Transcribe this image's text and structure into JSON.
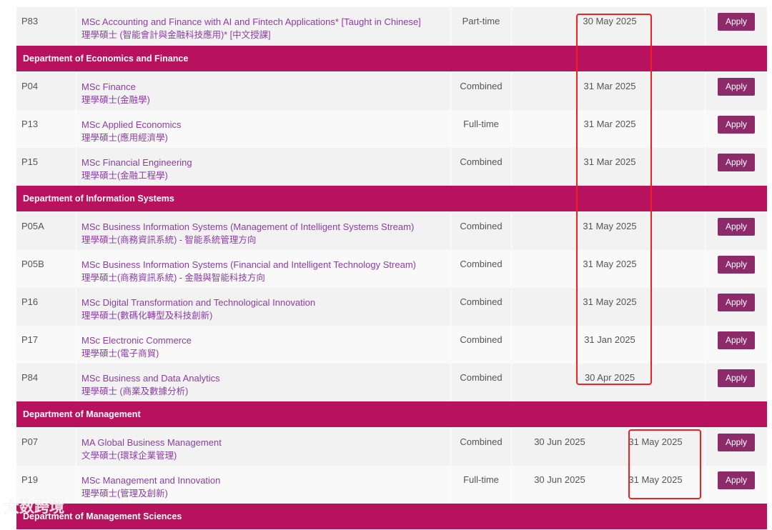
{
  "colors": {
    "dept_bg": "#b8125f",
    "link": "#8b3da3",
    "apply_bg": "#8d2a6a",
    "highlight": "#ee2020"
  },
  "apply_label": "Apply",
  "rows": [
    {
      "kind": "prog",
      "code": "P83",
      "en": "MSc Accounting and Finance with AI and Fintech Applications* [Taught in Chinese]",
      "zh": "理學碩士 (智能會計與金融科技應用)* [中文授課]",
      "mode": "Part-time",
      "date1": "",
      "date2": "30 May 2025"
    },
    {
      "kind": "dept",
      "label": "Department of Economics and Finance"
    },
    {
      "kind": "prog",
      "code": "P04",
      "en": "MSc Finance",
      "zh": "理學碩士(金融學)",
      "mode": "Combined",
      "date1": "",
      "date2": "31 Mar 2025"
    },
    {
      "kind": "prog",
      "code": "P13",
      "en": "MSc Applied Economics",
      "zh": "理學碩士(應用經濟學)",
      "mode": "Full-time",
      "date1": "",
      "date2": "31 Mar 2025"
    },
    {
      "kind": "prog",
      "code": "P15",
      "en": "MSc Financial Engineering",
      "zh": "理學碩士(金融工程學)",
      "mode": "Combined",
      "date1": "",
      "date2": "31 Mar 2025"
    },
    {
      "kind": "dept",
      "label": "Department of Information Systems"
    },
    {
      "kind": "prog",
      "code": "P05A",
      "en": "MSc Business Information Systems (Management of Intelligent Systems Stream)",
      "zh": "理學碩士(商務資訊系統) - 智能系統管理方向",
      "mode": "Combined",
      "date1": "",
      "date2": "31 May 2025"
    },
    {
      "kind": "prog",
      "code": "P05B",
      "en": "MSc Business Information Systems (Financial and Intelligent Technology Stream)",
      "zh": "理學碩士(商務資訊系統) - 金融與智能科技方向",
      "mode": "Combined",
      "date1": "",
      "date2": "31 May 2025"
    },
    {
      "kind": "prog",
      "code": "P16",
      "en": "MSc Digital Transformation and Technological Innovation",
      "zh": "理學碩士(數碼化轉型及科技創新)",
      "mode": "Combined",
      "date1": "",
      "date2": "31 May 2025"
    },
    {
      "kind": "prog",
      "code": "P17",
      "en": "MSc Electronic Commerce",
      "zh": "理學碩士(電子商貿)",
      "mode": "Combined",
      "date1": "",
      "date2": "31 Jan 2025"
    },
    {
      "kind": "prog",
      "code": "P84",
      "en": "MSc Business and Data Analytics",
      "zh": "理學碩士 (商業及數據分析)",
      "mode": "Combined",
      "date1": "",
      "date2": "30 Apr 2025"
    },
    {
      "kind": "dept",
      "label": "Department of Management"
    },
    {
      "kind": "prog",
      "code": "P07",
      "en": "MA Global Business Management",
      "zh": "文學碩士(環球企業管理)",
      "mode": "Combined",
      "date1": "30 Jun 2025",
      "date2": "31 May 2025"
    },
    {
      "kind": "prog",
      "code": "P19",
      "en": "MSc Management and Innovation",
      "zh": "理學碩士(管理及創新)",
      "mode": "Full-time",
      "date1": "30 Jun 2025",
      "date2": "31 May 2025"
    },
    {
      "kind": "dept",
      "label": "Department of Management Sciences"
    }
  ],
  "watermark": "大数跨境"
}
